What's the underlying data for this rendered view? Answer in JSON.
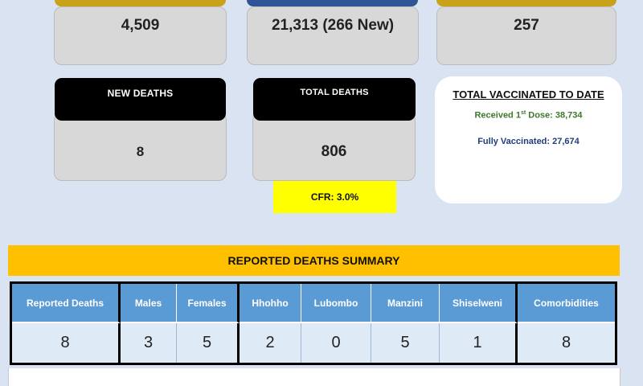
{
  "top_cards": [
    {
      "value": "4,509",
      "header_color": "#c9a21a"
    },
    {
      "value": "21,313 (266 New)",
      "header_color": "#2f5597"
    },
    {
      "value": "257",
      "header_color": "#c9a21a"
    }
  ],
  "deaths": {
    "new_label": "NEW DEATHS",
    "new_value": "8",
    "total_label": "TOTAL DEATHS",
    "total_value": "806",
    "cfr": "CFR: 3.0%"
  },
  "vaccinated": {
    "title": "TOTAL VACCINATED TO DATE",
    "first_dose_prefix": "Received 1",
    "first_dose_sup": "st",
    "first_dose_suffix": " Dose: 38,734",
    "fully": "Fully Vaccinated: 27,674"
  },
  "summary": {
    "title": "REPORTED DEATHS SUMMARY",
    "headers": [
      "Reported Deaths",
      "Males",
      "Females",
      "Hhohho",
      "Lubombo",
      "Manzini",
      "Shiselweni",
      "Comorbidities"
    ],
    "values": [
      "8",
      "3",
      "5",
      "2",
      "0",
      "5",
      "1",
      "8"
    ]
  }
}
